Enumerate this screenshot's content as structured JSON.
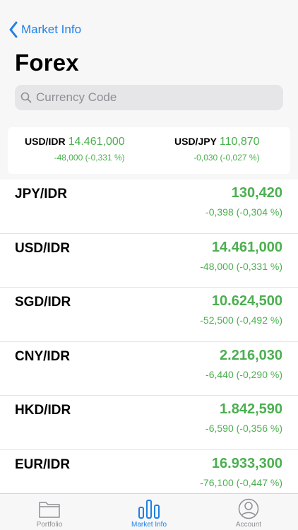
{
  "nav": {
    "back_label": "Market Info",
    "title": "Forex"
  },
  "search": {
    "placeholder": "Currency Code"
  },
  "summary": [
    {
      "pair": "USD/IDR",
      "price": "14.461,000",
      "change": "-48,000 (-0,331 %)"
    },
    {
      "pair": "USD/JPY",
      "price": "110,870",
      "change": "-0,030 (-0,027 %)"
    }
  ],
  "rates": [
    {
      "pair": "JPY/IDR",
      "price": "130,420",
      "change": "-0,398 (-0,304 %)"
    },
    {
      "pair": "USD/IDR",
      "price": "14.461,000",
      "change": "-48,000 (-0,331 %)"
    },
    {
      "pair": "SGD/IDR",
      "price": "10.624,500",
      "change": "-52,500 (-0,492 %)"
    },
    {
      "pair": "CNY/IDR",
      "price": "2.216,030",
      "change": "-6,440 (-0,290 %)"
    },
    {
      "pair": "HKD/IDR",
      "price": "1.842,590",
      "change": "-6,590 (-0,356 %)"
    },
    {
      "pair": "EUR/IDR",
      "price": "16.933,300",
      "change": "-76,100 (-0,447 %)"
    }
  ],
  "tabbar": {
    "items": [
      {
        "label": "Portfolio",
        "icon": "folder-icon"
      },
      {
        "label": "Market Info",
        "icon": "bar-chart-icon"
      },
      {
        "label": "Account",
        "icon": "user-icon"
      }
    ],
    "active_color": "#1f7fe5"
  },
  "colors": {
    "accent": "#1f7fe5",
    "positive_green": "#4caf50"
  }
}
